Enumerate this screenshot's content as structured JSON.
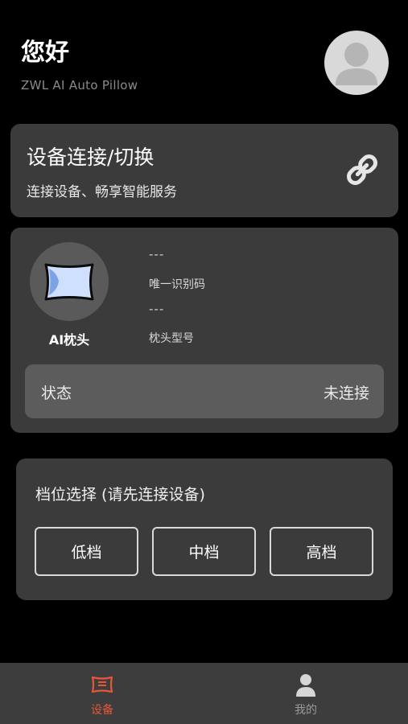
{
  "header": {
    "greeting": "您好",
    "subtitle": "ZWL AI Auto Pillow"
  },
  "connect": {
    "title": "设备连接/切换",
    "description": "连接设备、畅享智能服务",
    "icon": "link-icon"
  },
  "device": {
    "name": "AI枕头",
    "uid_value": "---",
    "uid_label": "唯一识别码",
    "model_value": "---",
    "model_label": "枕头型号",
    "status_label": "状态",
    "status_value": "未连接"
  },
  "level": {
    "title": "档位选择 (请先连接设备)",
    "options": [
      "低档",
      "中档",
      "高档"
    ]
  },
  "tabbar": {
    "items": [
      {
        "label": "设备",
        "icon": "pillow-icon",
        "active": true
      },
      {
        "label": "我的",
        "icon": "person-icon",
        "active": false
      }
    ]
  },
  "colors": {
    "accent": "#e8563a",
    "card": "#3b3b3b",
    "inactive": "#9a9a9a"
  }
}
